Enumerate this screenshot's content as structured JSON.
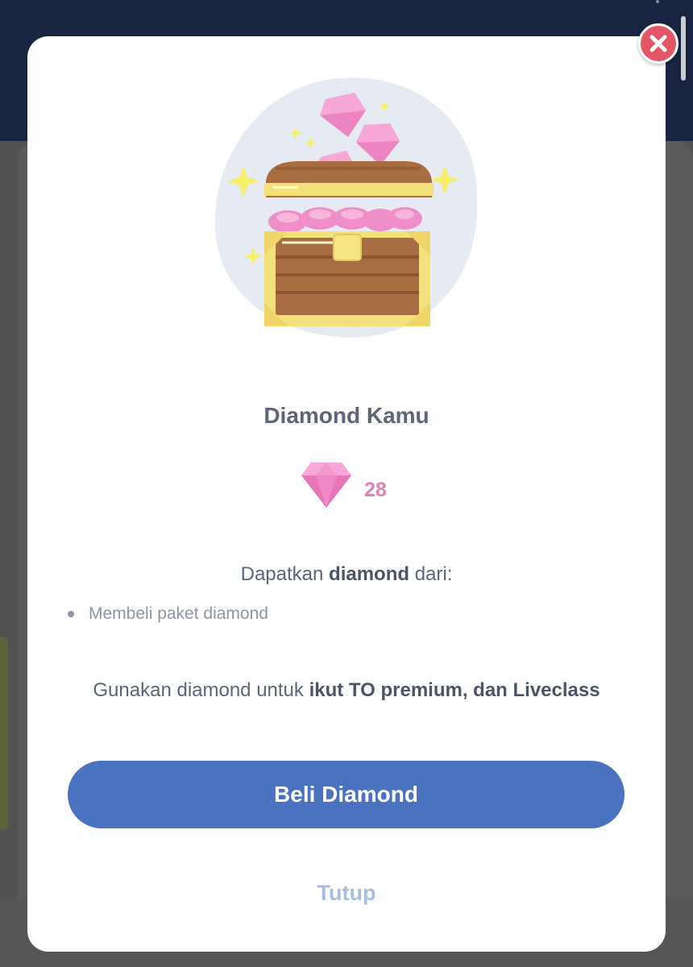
{
  "modal": {
    "title": "Diamond Kamu",
    "balance": "28",
    "earn": {
      "prefix": "Dapatkan",
      "highlight": "diamond",
      "suffix": "dari:",
      "items": [
        "Membeli paket diamond"
      ]
    },
    "usage": {
      "prefix": "Gunakan diamond untuk",
      "highlight": "ikut TO premium, dan Liveclass"
    },
    "buy_button_label": "Beli Diamond",
    "close_link_label": "Tutup"
  },
  "icons": {
    "close": "close-icon",
    "diamond": "diamond-icon",
    "illustration": "treasure-chest-illustration"
  },
  "colors": {
    "primary": "#4a72c0",
    "diamond_pink": "#e57fb7",
    "close_red": "#e25667",
    "header_navy": "#182440"
  }
}
